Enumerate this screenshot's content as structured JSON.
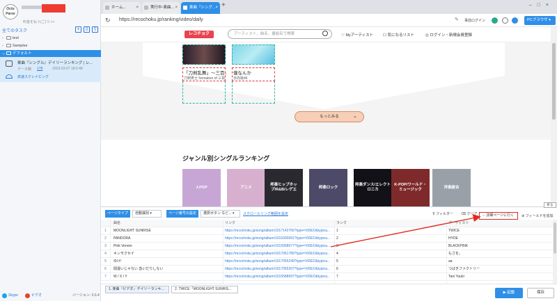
{
  "sidebar": {
    "avatar_text": "Octo Parse",
    "account_sub": "料金を払う(ご)つ >>",
    "all_tasks": "全てのタスク",
    "tree": [
      {
        "label": "test"
      },
      {
        "label": "Samples"
      },
      {
        "label": "デフォルト"
      }
    ],
    "task": {
      "title": "楽曲『シングル』デイリーランキング | レ...",
      "meta_label": "データ数:",
      "meta_count": "178",
      "meta_date": "2023-03-07 18:0:48",
      "status": "高速スクレイピング"
    },
    "footer": {
      "skype": "Skype",
      "video": "ビデオ",
      "version": "バージョン: 3.6.4"
    }
  },
  "browser": {
    "tabs": [
      {
        "label": "ホーム..."
      },
      {
        "label": "実行中-楽曲..."
      },
      {
        "label": "楽曲『シング..."
      }
    ],
    "url": "https://recochoku.jp/ranking/video/daily",
    "login_label": "事前ログイン",
    "pc_browser": "PCブラウザ"
  },
  "site": {
    "logo": "レコチョク",
    "search_placeholder": "アーティスト、曲名、番組名で検索",
    "my_artist": "Myアーティスト",
    "wishlist": "気になるリスト",
    "login": "ログイン・新規会員登録",
    "songs": [
      {
        "title": "「刀剣乱舞」〜三百...",
        "artist": "刀剣男士 formation of 三百"
      },
      {
        "title": "僕なんか",
        "artist": "日向坂46"
      }
    ],
    "more_label": "もっとみる",
    "genre_heading": "ジャンル別シングルランキング",
    "genres": [
      {
        "label": "J-POP",
        "color": "#c7a6d6"
      },
      {
        "label": "アニメ",
        "color": "#d7b0cf"
      },
      {
        "label": "邦楽ヒップホップ/R&B/レゲエ",
        "color": "#2b2930"
      },
      {
        "label": "邦楽ロック",
        "color": "#4c4a68"
      },
      {
        "label": "邦楽ダンス/エレクトロニカ",
        "color": "#111117"
      },
      {
        "label": "K-POP/ワールド・ミュージック",
        "color": "#7e2a2a"
      },
      {
        "label": "洋楽総合",
        "color": "#9aa0a8"
      }
    ]
  },
  "panel": {
    "collapse": "折る",
    "page_type_tag": "ページタイプ",
    "page_type_value": "自動識別",
    "page_number_tag": "ページ番号の設定",
    "page_number_value": "選択ボタン など...",
    "scroll_settings": "スクロールリング範囲を設定",
    "filter": "フィルター",
    "clear": "クリア",
    "detail": "詳細ページに行く",
    "add_field": "フィールドを追加",
    "columns": [
      "曲名",
      "リンク",
      "ランク",
      "アーティスト"
    ],
    "rows": [
      {
        "n": "1",
        "title": "MOONLIGHT SUNRISE",
        "link": "https://recochoku.jp/song/album/1017142756?type=VIDEO&typica...",
        "rank": "1",
        "artist": "TWICE"
      },
      {
        "n": "2",
        "title": "PANDORA",
        "link": "https://recochoku.jp/song/album/1016300091?type=VIDEO&typica...",
        "rank": "2",
        "artist": "HYDE"
      },
      {
        "n": "3",
        "title": "Pink Venom",
        "link": "https://recochoku.jp/song/album/1015958677?type=VIDEO&typica...",
        "rank": "3",
        "artist": "BLACKPINK"
      },
      {
        "n": "4",
        "title": "キンモクセイ",
        "link": "https://recochoku.jp/song/album/1017061789?type=VIDEO&typica...",
        "rank": "4",
        "artist": "もさを。"
      },
      {
        "n": "5",
        "title": "ゆけ!",
        "link": "https://recochoku.jp/song/album/1017055249?type=VIDEO&typica...",
        "rank": "5",
        "artist": "aa"
      },
      {
        "n": "6",
        "title": "間違いじゃない 急いだりしない",
        "link": "https://recochoku.jp/song/album/1017055207?type=VIDEO&typica...",
        "rank": "6",
        "artist": "つばきファクトリー"
      },
      {
        "n": "7",
        "title": "W / X / Y",
        "link": "https://recochoku.jp/song/album/1015588697?type=VIDEO&typica...",
        "rank": "7",
        "artist": "Tani Yuuki"
      }
    ],
    "bottom_tabs": [
      "1. 楽曲『ビデオ』デイリーランキ...",
      "2. TWICE「MOONLIGHT SUNRIS..."
    ],
    "start": "起動",
    "save": "保存"
  }
}
